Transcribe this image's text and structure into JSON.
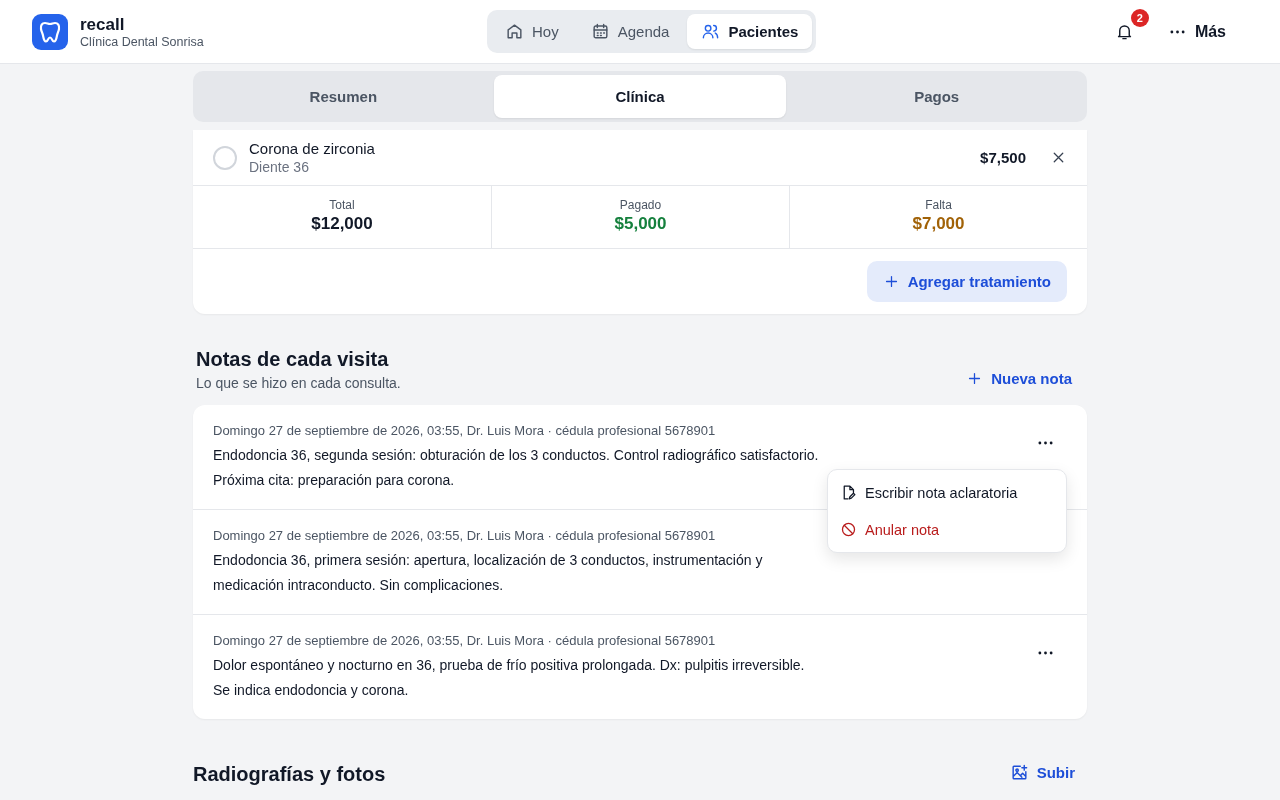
{
  "brand": {
    "name": "recall",
    "clinic": "Clínica Dental Sonrisa"
  },
  "nav": [
    {
      "label": "Hoy",
      "selected": false
    },
    {
      "label": "Agenda",
      "selected": false
    },
    {
      "label": "Pacientes",
      "selected": true
    }
  ],
  "notifications": {
    "count": "2"
  },
  "more": {
    "label": "Más"
  },
  "tabs": [
    {
      "label": "Resumen",
      "selected": false
    },
    {
      "label": "Clínica",
      "selected": true
    },
    {
      "label": "Pagos",
      "selected": false
    }
  ],
  "treatment": {
    "name": "Corona de zirconia",
    "tooth": "Diente 36",
    "price": "$7,500",
    "checked": false
  },
  "totals": [
    {
      "label": "Total",
      "value": "$12,000",
      "kind": "total"
    },
    {
      "label": "Pagado",
      "value": "$5,000",
      "kind": "paid"
    },
    {
      "label": "Falta",
      "value": "$7,000",
      "kind": "due"
    }
  ],
  "add_button": "Agregar tratamiento",
  "notes": {
    "title": "Notas de cada visita",
    "subtitle": "Lo que se hizo en cada consulta.",
    "new_button": "Nueva nota",
    "items": [
      {
        "meta": "Domingo 27 de septiembre de 2026, 03:55, Dr. Luis Mora · cédula profesional 5678901",
        "text": "Endodoncia 36, segunda sesión: obturación de los 3 conductos. Control radiográfico satisfactorio. Próxima cita: preparación para corona.",
        "menu_open": true
      },
      {
        "meta": "Domingo 27 de septiembre de 2026, 03:55, Dr. Luis Mora · cédula profesional 5678901",
        "text": "Endodoncia 36, primera sesión: apertura, localización de 3 conductos, instrumentación y medicación intraconducto. Sin complicaciones.",
        "menu_open": false
      },
      {
        "meta": "Domingo 27 de septiembre de 2026, 03:55, Dr. Luis Mora · cédula profesional 5678901",
        "text": "Dolor espontáneo y nocturno en 36, prueba de frío positiva prolongada. Dx: pulpitis irreversible. Se indica endodoncia y corona.",
        "menu_open": false
      }
    ],
    "menu": [
      {
        "label": "Escribir nota aclaratoria",
        "kind": "amend"
      },
      {
        "label": "Anular nota",
        "kind": "void"
      }
    ]
  },
  "media": {
    "title": "Radiografías y fotos",
    "upload": "Subir"
  }
}
